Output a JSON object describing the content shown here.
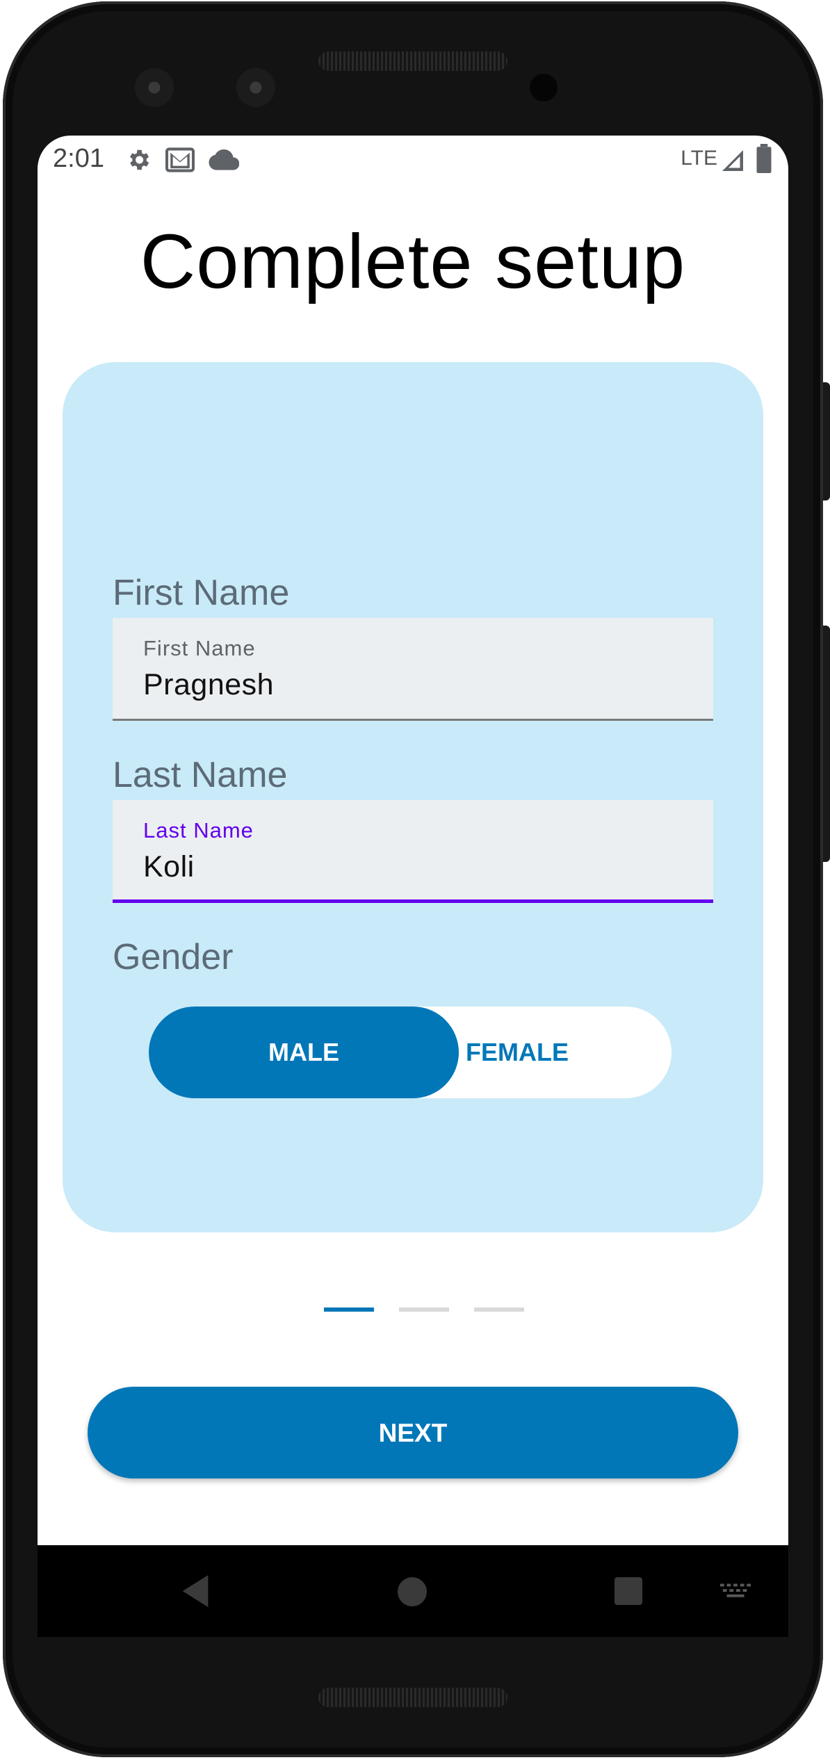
{
  "status_bar": {
    "time": "2:01",
    "network_label": "LTE",
    "icons": [
      "settings-icon",
      "mail-icon",
      "cloud-icon",
      "signal-icon",
      "battery-icon"
    ]
  },
  "page": {
    "title": "Complete setup"
  },
  "form": {
    "first_name": {
      "section_label": "First Name",
      "floating_label": "First Name",
      "value": "Pragnesh",
      "focused": false
    },
    "last_name": {
      "section_label": "Last Name",
      "floating_label": "Last Name",
      "value": "Koli",
      "focused": true
    },
    "gender": {
      "section_label": "Gender",
      "options": [
        "MALE",
        "FEMALE"
      ],
      "selected": "MALE"
    }
  },
  "pager": {
    "total_steps": 3,
    "current_step": 1
  },
  "actions": {
    "next_label": "NEXT"
  },
  "navigation_bar": {
    "icons": [
      "back-icon",
      "home-icon",
      "recents-icon",
      "keyboard-icon"
    ]
  },
  "colors": {
    "primary": "#0177b8",
    "card_background": "#c9eaf8",
    "focus_accent": "#6200ee",
    "field_background": "#eceff1"
  }
}
